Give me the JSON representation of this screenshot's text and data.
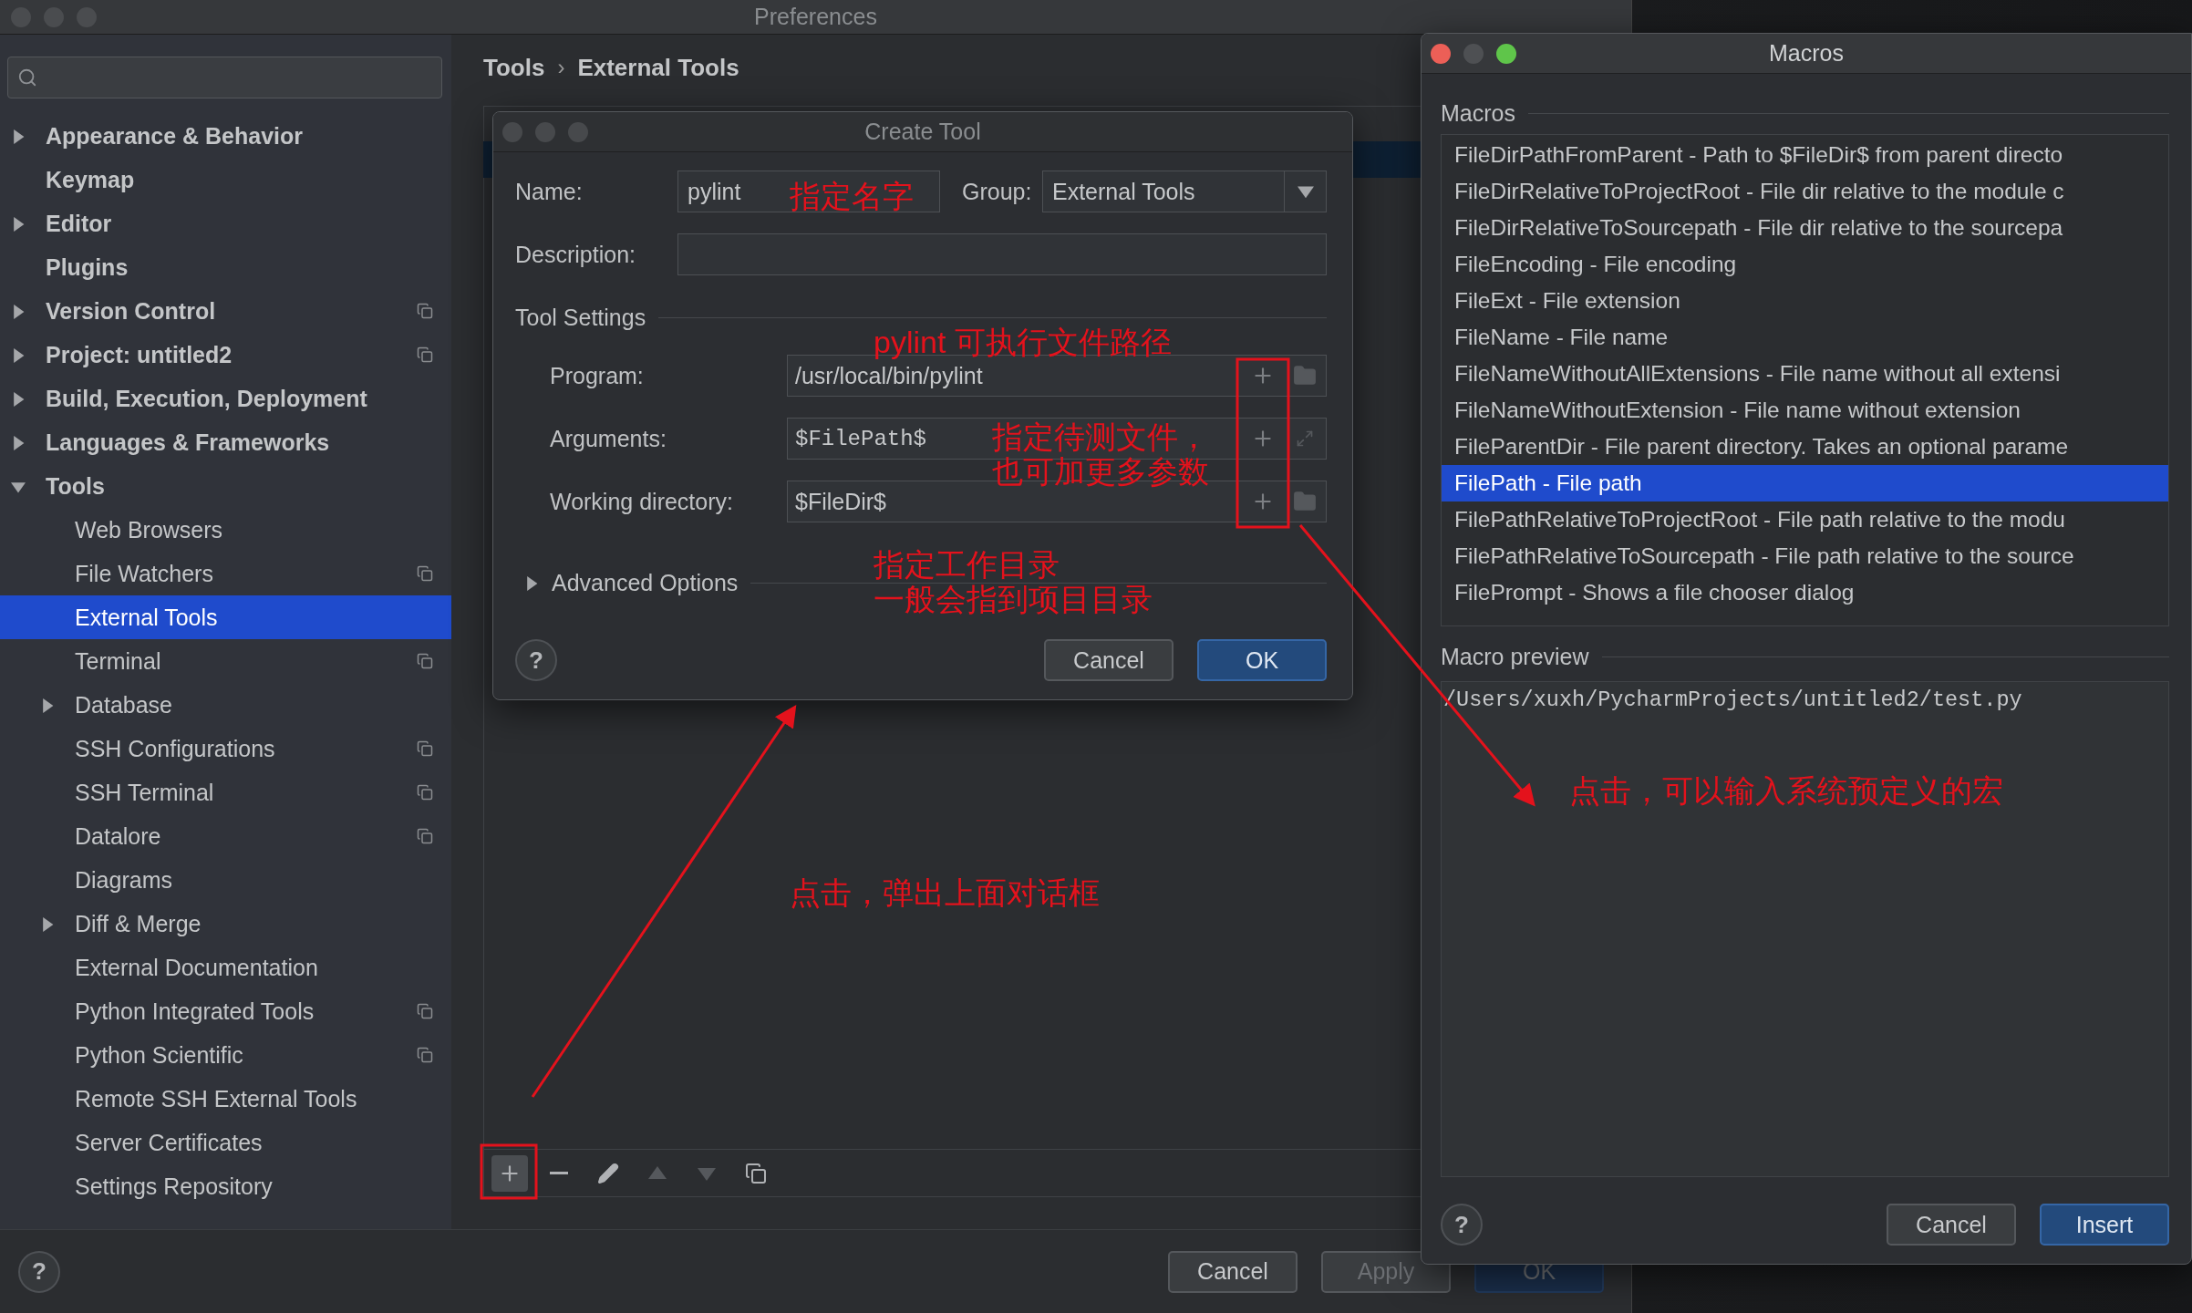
{
  "preferences": {
    "title": "Preferences",
    "sidebar": {
      "items": [
        {
          "label": "Appearance & Behavior",
          "expanded": false,
          "selected": false,
          "project": false
        },
        {
          "label": "Keymap",
          "selected": false,
          "project": false
        },
        {
          "label": "Editor",
          "expanded": false,
          "selected": false,
          "project": false
        },
        {
          "label": "Plugins",
          "selected": false,
          "project": false
        },
        {
          "label": "Version Control",
          "expanded": false,
          "selected": false,
          "project": true
        },
        {
          "label": "Project: untitled2",
          "expanded": false,
          "selected": false,
          "project": true
        },
        {
          "label": "Build, Execution, Deployment",
          "expanded": false,
          "selected": false,
          "project": false
        },
        {
          "label": "Languages & Frameworks",
          "expanded": false,
          "selected": false,
          "project": false
        },
        {
          "label": "Tools",
          "expanded": true,
          "selected": false,
          "project": false,
          "children": [
            {
              "label": "Web Browsers",
              "selected": false,
              "project": false
            },
            {
              "label": "File Watchers",
              "selected": false,
              "project": true
            },
            {
              "label": "External Tools",
              "selected": true,
              "project": false
            },
            {
              "label": "Terminal",
              "selected": false,
              "project": true
            },
            {
              "label": "Database",
              "expanded": false,
              "selected": false,
              "project": false
            },
            {
              "label": "SSH Configurations",
              "selected": false,
              "project": true
            },
            {
              "label": "SSH Terminal",
              "selected": false,
              "project": true
            },
            {
              "label": "Datalore",
              "selected": false,
              "project": true
            },
            {
              "label": "Diagrams",
              "selected": false,
              "project": false
            },
            {
              "label": "Diff & Merge",
              "expanded": false,
              "selected": false,
              "project": false
            },
            {
              "label": "External Documentation",
              "selected": false,
              "project": false
            },
            {
              "label": "Python Integrated Tools",
              "selected": false,
              "project": true
            },
            {
              "label": "Python Scientific",
              "selected": false,
              "project": true
            },
            {
              "label": "Remote SSH External Tools",
              "selected": false,
              "project": false
            },
            {
              "label": "Server Certificates",
              "selected": false,
              "project": false
            },
            {
              "label": "Settings Repository",
              "selected": false,
              "project": false
            }
          ]
        }
      ]
    },
    "breadcrumb": {
      "items": [
        "Tools",
        "External Tools"
      ],
      "separator": "›"
    },
    "toolbar": [
      {
        "kind": "add",
        "disabled": false
      },
      {
        "kind": "remove",
        "disabled": false
      },
      {
        "kind": "edit",
        "disabled": false
      },
      {
        "kind": "up",
        "disabled": true
      },
      {
        "kind": "down",
        "disabled": true
      },
      {
        "kind": "copy",
        "disabled": false
      }
    ],
    "help": "?",
    "buttons": [
      {
        "label": "Cancel",
        "kind": "default",
        "disabled": false
      },
      {
        "label": "Apply",
        "kind": "default",
        "disabled": true
      },
      {
        "label": "OK",
        "kind": "primary",
        "disabled": true
      }
    ]
  },
  "create_tool": {
    "title": "Create Tool",
    "name": {
      "label": "Name:",
      "value": "pylint"
    },
    "group": {
      "label": "Group:",
      "value": "External Tools"
    },
    "description": {
      "label": "Description:"
    },
    "section": "Tool Settings",
    "fields": [
      {
        "label": "Program:",
        "value": "/usr/local/bin/pylint",
        "kind": "folder"
      },
      {
        "label": "Arguments:",
        "value": "$FilePath$",
        "kind": "expand"
      },
      {
        "label": "Working directory:",
        "value": "$FileDir$",
        "kind": "folder"
      }
    ],
    "advanced": {
      "label": "Advanced Options",
      "expanded": false
    },
    "help": "?",
    "buttons": [
      {
        "label": "Cancel",
        "kind": "default"
      },
      {
        "label": "OK",
        "kind": "primary"
      }
    ]
  },
  "macros": {
    "title": "Macros",
    "section": "Macros",
    "items": [
      {
        "label": "FileDirPathFromParent - Path to $FileDir$ from parent directo",
        "selected": false
      },
      {
        "label": "FileDirRelativeToProjectRoot - File dir relative to the module c",
        "selected": false
      },
      {
        "label": "FileDirRelativeToSourcepath - File dir relative to the sourcepa",
        "selected": false
      },
      {
        "label": "FileEncoding - File encoding",
        "selected": false
      },
      {
        "label": "FileExt - File extension",
        "selected": false
      },
      {
        "label": "FileName - File name",
        "selected": false
      },
      {
        "label": "FileNameWithoutAllExtensions - File name without all extensi",
        "selected": false
      },
      {
        "label": "FileNameWithoutExtension - File name without extension",
        "selected": false
      },
      {
        "label": "FileParentDir - File parent directory. Takes an optional parame",
        "selected": false
      },
      {
        "label": "FilePath - File path",
        "selected": true
      },
      {
        "label": "FilePathRelativeToProjectRoot - File path relative to the modu",
        "selected": false
      },
      {
        "label": "FilePathRelativeToSourcepath - File path relative to the source",
        "selected": false
      },
      {
        "label": "FilePrompt - Shows a file chooser dialog",
        "selected": false
      }
    ],
    "preview_label": "Macro preview",
    "preview": "/Users/xuxh/PycharmProjects/untitled2/test.py",
    "help": "?",
    "buttons": [
      {
        "label": "Cancel",
        "kind": "default"
      },
      {
        "label": "Insert",
        "kind": "primary"
      }
    ]
  },
  "annotations": [
    {
      "lines": [
        "指定名字"
      ]
    },
    {
      "lines": [
        "pylint 可执行文件路径"
      ]
    },
    {
      "lines": [
        "指定待测文件，",
        "也可加更多参数"
      ]
    },
    {
      "lines": [
        "指定工作目录",
        "一般会指到项目目录"
      ]
    },
    {
      "lines": [
        "点击，可以输入系统预定义的宏"
      ]
    },
    {
      "lines": [
        "点击，弹出上面对话框"
      ]
    }
  ]
}
